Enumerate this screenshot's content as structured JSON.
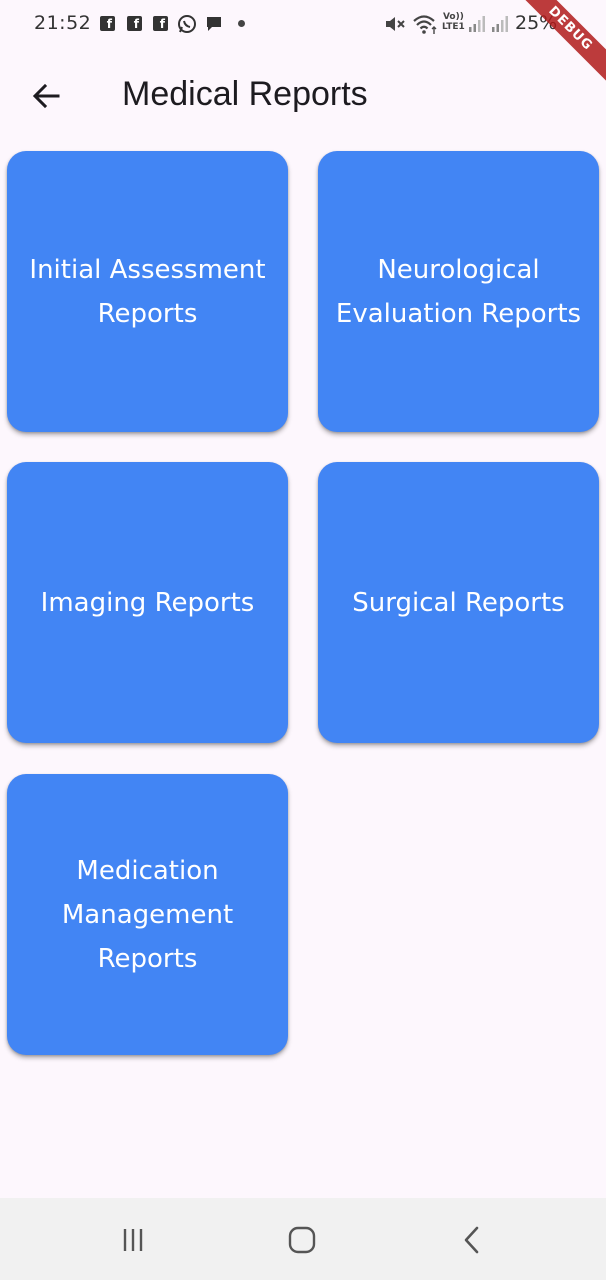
{
  "status_bar": {
    "time": "21:52",
    "notification_icons": [
      "facebook-icon",
      "facebook-icon",
      "facebook-icon",
      "whatsapp-icon",
      "message-icon",
      "more-dot-icon"
    ],
    "system_icons": [
      "mute-icon",
      "wifi-icon",
      "volte-icon",
      "signal-icon",
      "signal-icon"
    ],
    "volte_line1": "Vo))",
    "volte_line2": "LTE1",
    "battery": "25%",
    "debug_banner": "DEBUG"
  },
  "app_bar": {
    "back_icon": "arrow-back-icon",
    "title": "Medical Reports"
  },
  "report_cards": [
    {
      "label": "Initial Assessment Reports"
    },
    {
      "label": "Neurological Evaluation Reports"
    },
    {
      "label": "Imaging Reports"
    },
    {
      "label": "Surgical Reports"
    },
    {
      "label": "Medication Management Reports"
    }
  ],
  "nav_bar": {
    "recents_icon": "recents-icon",
    "home_icon": "home-icon",
    "back_icon": "back-chevron-icon"
  },
  "colors": {
    "background": "#fdf7fd",
    "card": "#4285f4",
    "card_text": "#ffffff",
    "title_text": "#1d1b20",
    "nav_bar": "#f1f1f1",
    "debug_ribbon": "#b01a1a"
  }
}
